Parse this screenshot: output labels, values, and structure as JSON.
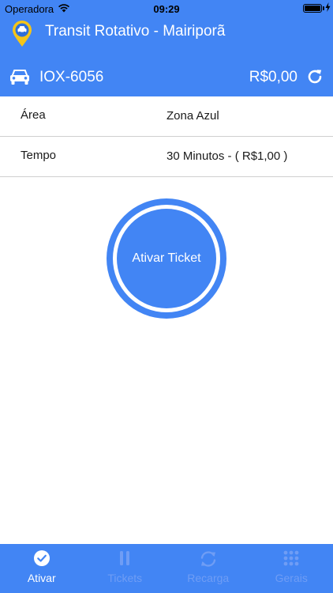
{
  "status_bar": {
    "carrier": "Operadora",
    "time": "09:29"
  },
  "header": {
    "title": "Transit Rotativo - Mairiporã"
  },
  "vehicle": {
    "plate": "IOX-6056",
    "balance": "R$0,00"
  },
  "rows": [
    {
      "label": "Área",
      "value": "Zona Azul"
    },
    {
      "label": "Tempo",
      "value": "30 Minutos - ( R$1,00 )"
    }
  ],
  "action": {
    "label": "Ativar Ticket"
  },
  "tabs": [
    {
      "label": "Ativar",
      "icon": "check-circle-icon",
      "active": true
    },
    {
      "label": "Tickets",
      "icon": "pause-icon",
      "active": false
    },
    {
      "label": "Recarga",
      "icon": "refresh-icon",
      "active": false
    },
    {
      "label": "Gerais",
      "icon": "grid-icon",
      "active": false
    }
  ],
  "colors": {
    "primary": "#4285f4",
    "tab_inactive": "#6f9df5",
    "logo_pin": "#f5c518"
  }
}
